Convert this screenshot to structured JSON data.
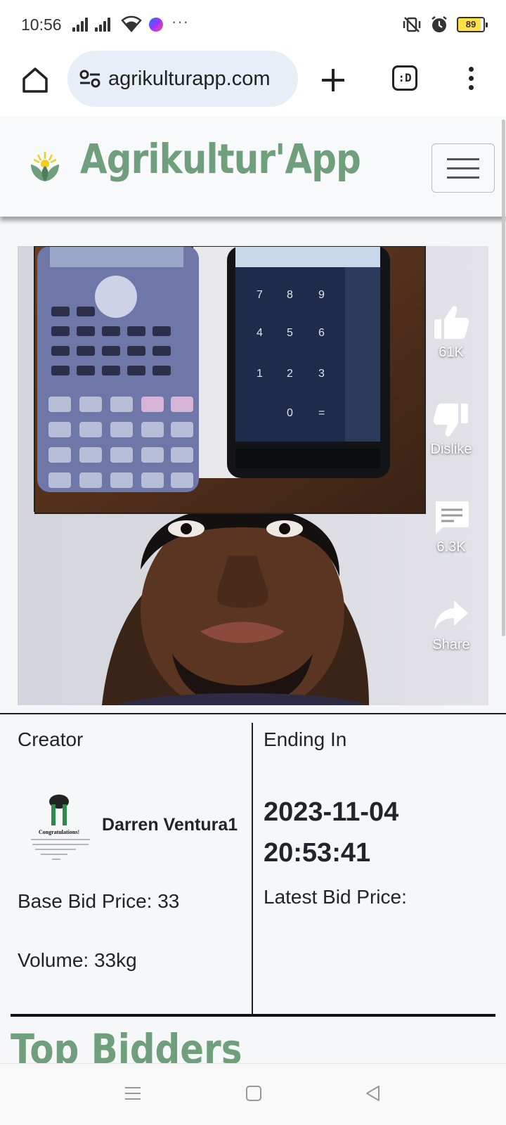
{
  "status_bar": {
    "time": "10:56",
    "battery": "89"
  },
  "browser": {
    "url": "agrikulturapp.com",
    "tabs_label": ":D"
  },
  "site": {
    "brand": "Agrikultur'App"
  },
  "video": {
    "actions": {
      "like": "61K",
      "dislike": "Dislike",
      "comments": "6.3K",
      "share": "Share"
    },
    "accent_color": "#ffffff"
  },
  "details": {
    "creator_label": "Creator",
    "creator_name": "Darren Ventura1",
    "avatar_caption": "Congratulations!",
    "ending_label": "Ending In",
    "ending_date": "2023-11-04",
    "ending_time": "20:53:41",
    "base_bid": "Base Bid Price: 33",
    "latest_bid": "Latest Bid Price:",
    "volume": "Volume: 33kg"
  },
  "section": {
    "top_bidders": "Top Bidders"
  },
  "colors": {
    "brand": "#6f9f7d",
    "logo_yellow": "#f2cf1f"
  },
  "icons": [
    "home-icon",
    "tune-icon",
    "plus-icon",
    "tabs-icon",
    "more-vert-icon",
    "thumb-up-icon",
    "thumb-down-icon",
    "comment-icon",
    "share-icon"
  ]
}
